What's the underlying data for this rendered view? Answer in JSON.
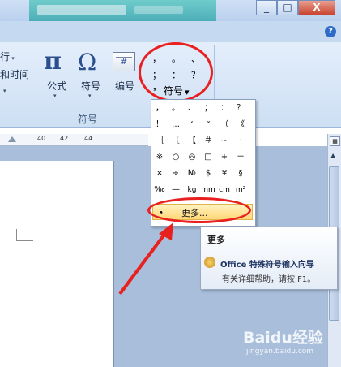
{
  "window": {
    "minimize": "_",
    "restore": "□",
    "close": "X",
    "help": "?"
  },
  "ribbon": {
    "partial_left": [
      "行",
      "和时间"
    ],
    "equation": "公式",
    "symbol": "符号",
    "number": "编号",
    "group_label": "符号",
    "number_icon": "#"
  },
  "symbol_group": {
    "row1": [
      "，",
      "。",
      "、"
    ],
    "row2": [
      "；",
      "：",
      "？"
    ],
    "label": "符号"
  },
  "ruler": [
    "40",
    "42",
    "44"
  ],
  "dropdown": {
    "rows": [
      [
        "，",
        "。",
        "、",
        "；",
        "：",
        "？"
      ],
      [
        "！",
        "…",
        "‘",
        "“",
        "（",
        "《"
      ],
      [
        "｛",
        "〖",
        "【",
        "＃",
        "~",
        "·"
      ],
      [
        "※",
        "○",
        "◎",
        "□",
        "+",
        "－"
      ],
      [
        "×",
        "÷",
        "№",
        "$",
        "¥",
        "§"
      ],
      [
        "‰",
        "—",
        "kg",
        "mm",
        "cm",
        "m²"
      ]
    ],
    "more": "更多..."
  },
  "tooltip": {
    "title": "更多",
    "line1": "Office 特殊符号输入向导",
    "line2": "有关详细帮助，请按 F1。"
  },
  "watermark": {
    "brand": "Baidu经验",
    "url": "jingyan.baidu.com"
  },
  "colors": {
    "ribbon": "#dde9f8",
    "highlight_circle": "#e82020",
    "menu_hover": "#ffd777"
  }
}
